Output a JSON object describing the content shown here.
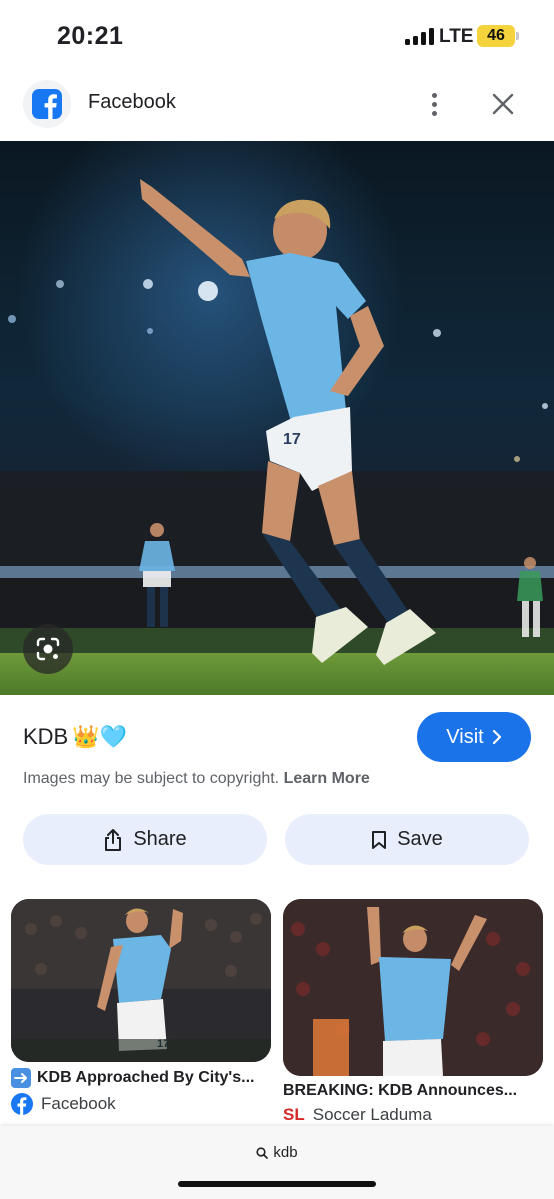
{
  "status_bar": {
    "time": "20:21",
    "network": "LTE",
    "battery": "46"
  },
  "header": {
    "title": "Facebook",
    "logo_icon": "facebook-icon",
    "more_icon": "more-vert-icon",
    "close_icon": "close-icon"
  },
  "image": {
    "title": "KDB",
    "title_emoji": "👑🩵",
    "copyright_text": "Images may be subject to copyright.",
    "learn_more": "Learn More",
    "visit_label": "Visit",
    "share_label": "Share",
    "save_label": "Save"
  },
  "related": [
    {
      "title": "KDB Approached By City's...",
      "prefix_icon": "arrow-right-emoji",
      "source": "Facebook",
      "source_icon": "facebook-icon"
    },
    {
      "title": "BREAKING: KDB Announces...",
      "source": "Soccer Laduma",
      "source_icon": "soccer-laduma-logo",
      "source_logo_text": "SL"
    }
  ],
  "bottom": {
    "query": "kdb",
    "search_icon": "search-icon"
  },
  "colors": {
    "accent": "#1a73e8",
    "button_bg": "#e8eefb",
    "city_blue": "#6cb6e6",
    "facebook_blue": "#1877f2"
  }
}
